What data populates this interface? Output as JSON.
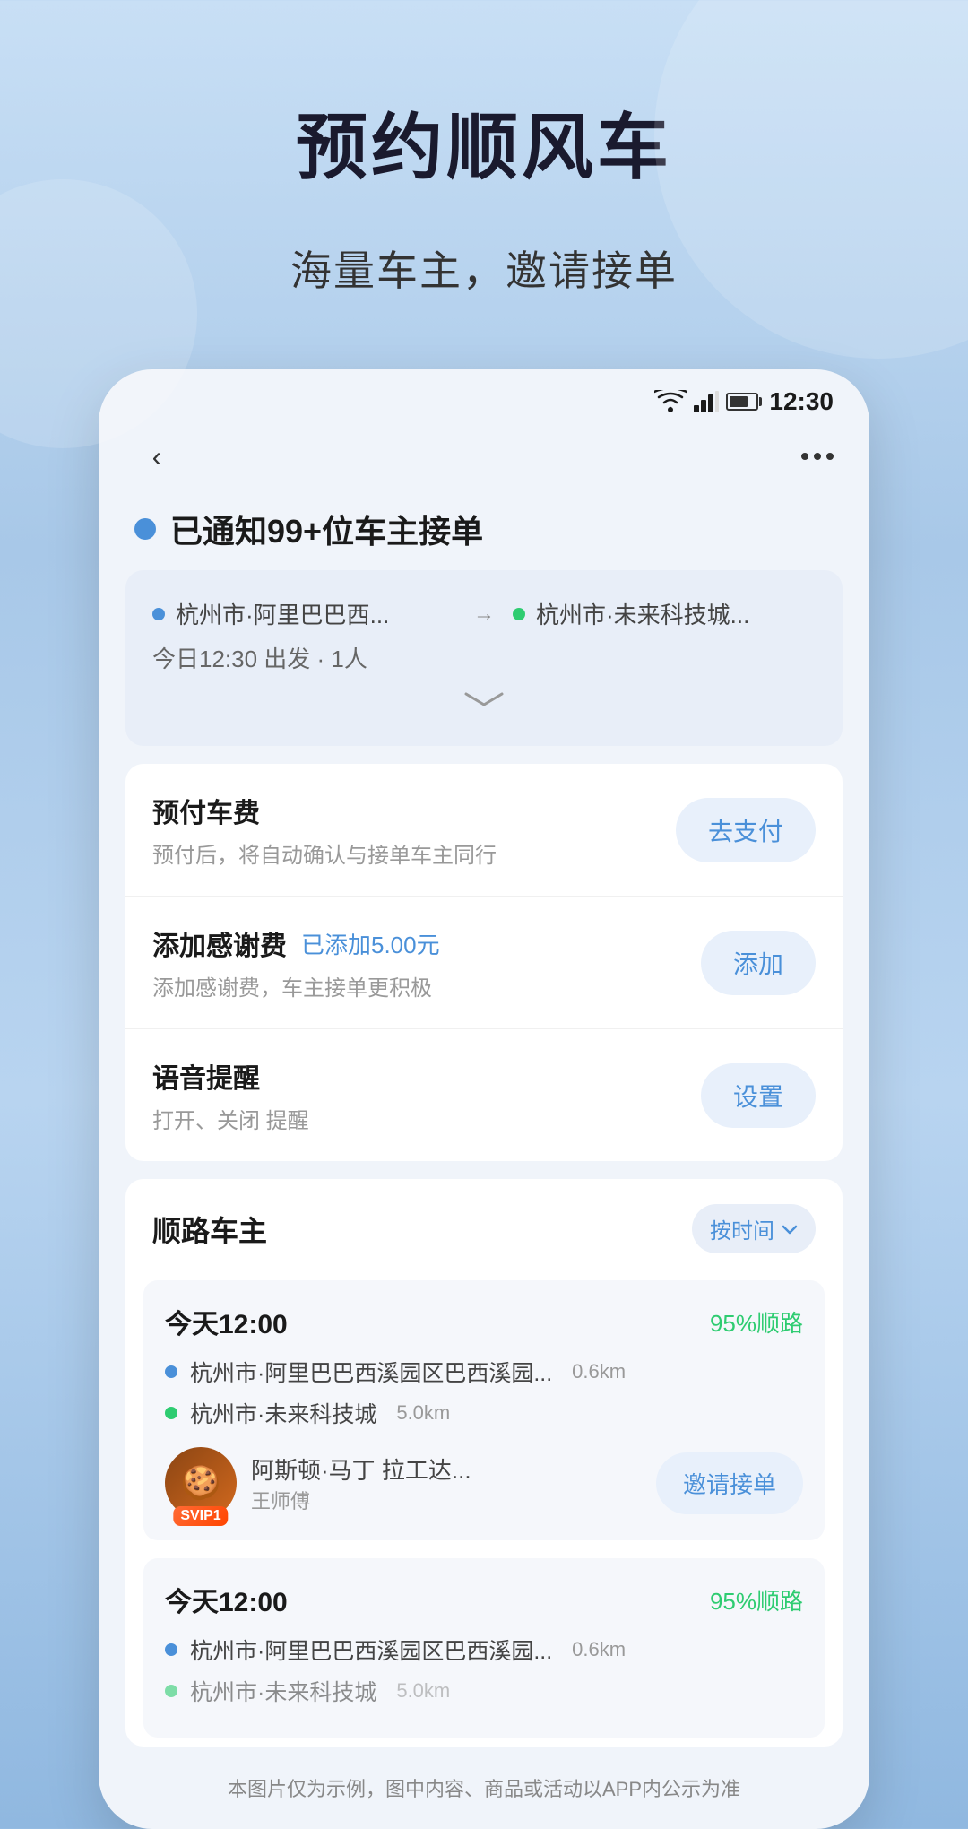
{
  "page": {
    "top_title": "预约顺风车",
    "subtitle": "海量车主，邀请接单"
  },
  "status_bar": {
    "time": "12:30"
  },
  "notification": {
    "text": "已通知99+位车主接单"
  },
  "route": {
    "origin": "杭州市·阿里巴巴西...",
    "destination": "杭州市·未来科技城...",
    "departure_info": "今日12:30 出发 · 1人"
  },
  "actions": {
    "prepay": {
      "title": "预付车费",
      "desc": "预付后，将自动确认与接单车主同行",
      "btn": "去支付"
    },
    "tip": {
      "title": "添加感谢费",
      "added": "已添加5.00元",
      "desc": "添加感谢费，车主接单更积极",
      "btn": "添加"
    },
    "voice": {
      "title": "语音提醒",
      "desc": "打开、关闭 提醒",
      "btn": "设置"
    }
  },
  "drivers": {
    "section_title": "顺路车主",
    "sort_label": "按时间",
    "cards": [
      {
        "time": "今天12:00",
        "match": "95%顺路",
        "origin": "杭州市·阿里巴巴西溪园区巴西溪园...",
        "origin_distance": "0.6km",
        "destination": "杭州市·未来科技城",
        "destination_distance": "5.0km",
        "driver_name": "阿斯顿·马丁 拉工达...",
        "driver_title": "王师傅",
        "invite_btn": "邀请接单",
        "svip": "SVIP1"
      },
      {
        "time": "今天12:00",
        "match": "95%顺路",
        "origin": "杭州市·阿里巴巴西溪园区巴西溪园...",
        "origin_distance": "0.6km",
        "destination": "杭州市·未来科技城",
        "destination_distance": "5.0km"
      }
    ]
  },
  "disclaimer": "本图片仅为示例，图中内容、商品或活动以APP内公示为准"
}
